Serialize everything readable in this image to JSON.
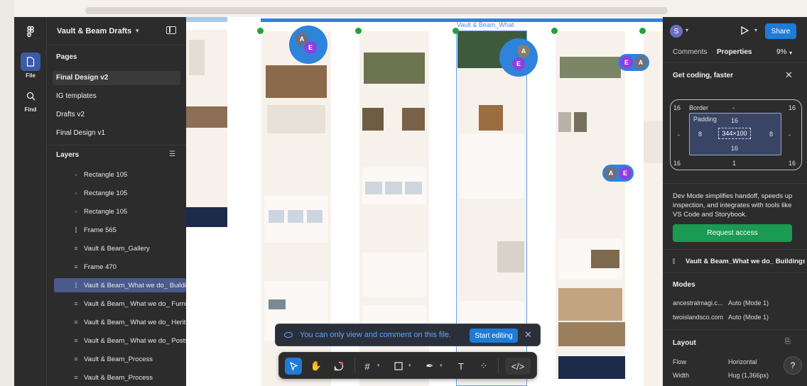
{
  "file": {
    "title": "Vault & Beam Drafts"
  },
  "rail": {
    "file_label": "File",
    "find_label": "Find"
  },
  "pages": {
    "title": "Pages",
    "items": [
      "Final Design v2",
      "IG templates",
      "Drafts v2",
      "Final Design v1"
    ],
    "selected_index": 0
  },
  "layers": {
    "title": "Layers",
    "items": [
      {
        "icon": "rectangle-icon",
        "label": "Rectangle 105"
      },
      {
        "icon": "rectangle-icon",
        "label": "Rectangle 105"
      },
      {
        "icon": "rectangle-icon",
        "label": "Rectangle 105"
      },
      {
        "icon": "frame-icon",
        "label": "Frame 565"
      },
      {
        "icon": "component-icon",
        "label": "Vault & Beam_Gallery"
      },
      {
        "icon": "component-icon",
        "label": "Frame 470"
      },
      {
        "icon": "frame-icon",
        "label": "Vault & Beam_What we do_ Buildings"
      },
      {
        "icon": "component-icon",
        "label": "Vault & Beam_ What we do_ Furniture"
      },
      {
        "icon": "component-icon",
        "label": "Vault & Beam_ What we do_ Heritage"
      },
      {
        "icon": "component-icon",
        "label": "Vault & Beam_ What we do_ Posts"
      },
      {
        "icon": "component-icon",
        "label": "Vault & Beam_Process"
      },
      {
        "icon": "component-icon",
        "label": "Vault & Beam_Process"
      }
    ],
    "selected_index": 6
  },
  "canvas": {
    "selected_frame_label": "Vault & Beam_What",
    "avatars": {
      "a": "A",
      "e": "E"
    }
  },
  "toast": {
    "message": "You can only view and comment on this file.",
    "action": "Start editing"
  },
  "right_panel": {
    "user_initial": "S",
    "share_label": "Share",
    "tabs": [
      "Comments",
      "Properties"
    ],
    "active_tab": "Properties",
    "zoom": "9%",
    "promo_title": "Get coding, faster",
    "box_model": {
      "border_label": "Border",
      "padding_label": "Padding",
      "outer_top_left": "16",
      "outer_top_mid": "-",
      "outer_top_right": "16",
      "outer_left": "-",
      "outer_right": "-",
      "outer_bottom_left": "16",
      "outer_bottom_mid": "1",
      "outer_bottom_right": "16",
      "pad_top": "16",
      "pad_left": "8",
      "pad_right": "8",
      "pad_bottom": "16",
      "size": "344×100"
    },
    "dev_text": "Dev Mode simplifies handoff, speeds up inspection, and integrates with tools like VS Code and Storybook.",
    "request_label": "Request access",
    "frame_name": "Vault & Beam_What we do_ Buildings",
    "modes_title": "Modes",
    "modes": [
      {
        "key": "ancestralmagi.c...",
        "value": "Auto (Mode 1)"
      },
      {
        "key": "twoislandsco.com",
        "value": "Auto (Mode 1)"
      }
    ],
    "layout_title": "Layout",
    "layout": [
      {
        "key": "Flow",
        "value": "Horizontal"
      },
      {
        "key": "Width",
        "value": "Hug (1,366px)"
      }
    ],
    "help_label": "?"
  },
  "colors": {
    "accent": "#1f7cd6",
    "selection": "#5b9de8",
    "avatar_blue": "#2e83db",
    "avatar_purple": "#8e3fe0",
    "success": "#1a9a52",
    "page_bg": "#f7f1ec",
    "navy": "#1c2b4a"
  }
}
